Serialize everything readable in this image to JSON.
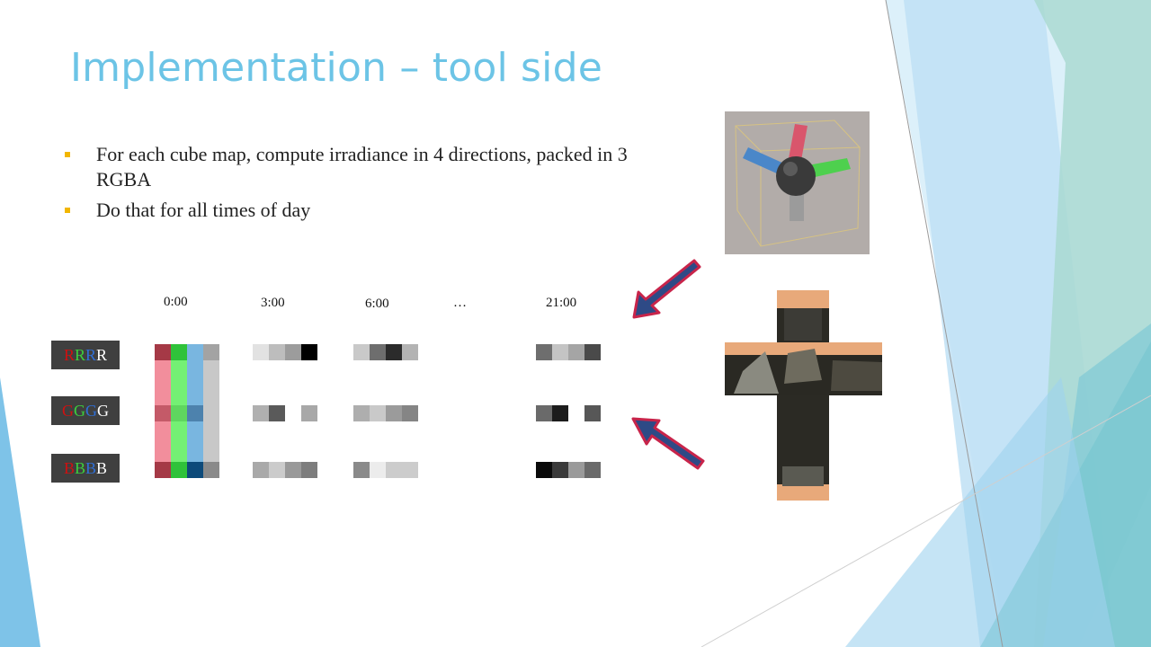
{
  "slide": {
    "title": "Implementation – tool side",
    "bullets": [
      "For each cube map, compute irradiance in 4 directions, packed in 3 RGBA",
      "Do that for all times of day"
    ]
  },
  "timeline": {
    "columns": [
      "0:00",
      "3:00",
      "6:00",
      "…",
      "21:00"
    ]
  },
  "rows": [
    {
      "chars": [
        "R",
        "R",
        "R",
        "R"
      ],
      "colors": [
        "#d01010",
        "#3ccf3c",
        "#2f6fd6",
        "#ffffff"
      ]
    },
    {
      "chars": [
        "G",
        "G",
        "G",
        "G"
      ],
      "colors": [
        "#d01010",
        "#3ccf3c",
        "#2f6fd6",
        "#ffffff"
      ]
    },
    {
      "chars": [
        "B",
        "B",
        "B",
        "B"
      ],
      "colors": [
        "#d01010",
        "#3ccf3c",
        "#2f6fd6",
        "#ffffff"
      ]
    }
  ],
  "colors": {
    "title": "#6cc4e6",
    "bullet_marker": "#f2b600",
    "label_bg": "#3f3f3f",
    "arrow_fill": "#2e4a86",
    "arrow_stroke": "#c8244a"
  }
}
